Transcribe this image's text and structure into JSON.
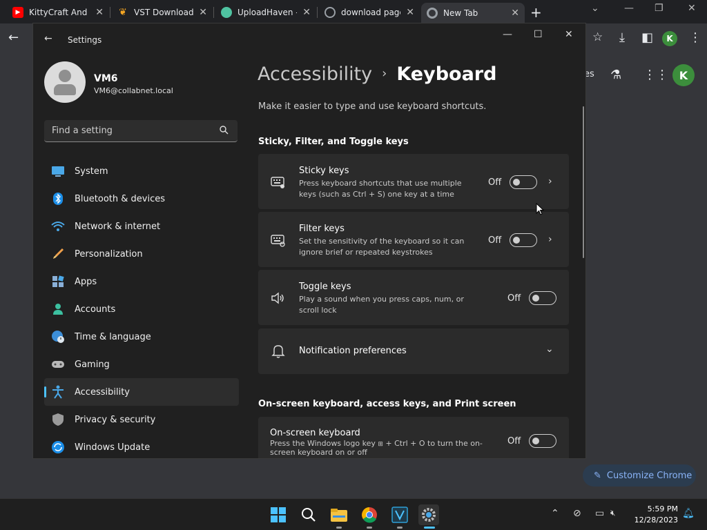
{
  "browser": {
    "tabs": [
      {
        "title": "KittyCraft And B",
        "favicon": "youtube-icon",
        "color": "#ff0000"
      },
      {
        "title": "VST Downloads",
        "favicon": "fl-studio-icon",
        "color": "#f5a623"
      },
      {
        "title": "UploadHaven -",
        "favicon": "cloud-icon",
        "color": "#4fc3a1"
      },
      {
        "title": "download page",
        "favicon": "globe-icon",
        "color": "#9aa0a6"
      },
      {
        "title": "New Tab",
        "favicon": "chrome-icon",
        "color": "#9aa0a6"
      }
    ],
    "profile_initial": "K",
    "page_partial_text": "es",
    "customize_label": "Customize Chrome"
  },
  "settings": {
    "app_title": "Settings",
    "user": {
      "name": "VM6",
      "email": "VM6@collabnet.local"
    },
    "search_placeholder": "Find a setting",
    "nav": [
      {
        "label": "System",
        "icon": "monitor-icon"
      },
      {
        "label": "Bluetooth & devices",
        "icon": "bluetooth-icon"
      },
      {
        "label": "Network & internet",
        "icon": "wifi-icon"
      },
      {
        "label": "Personalization",
        "icon": "brush-icon"
      },
      {
        "label": "Apps",
        "icon": "apps-icon"
      },
      {
        "label": "Accounts",
        "icon": "person-icon"
      },
      {
        "label": "Time & language",
        "icon": "globe-clock-icon"
      },
      {
        "label": "Gaming",
        "icon": "gamepad-icon"
      },
      {
        "label": "Accessibility",
        "icon": "accessibility-icon",
        "selected": true
      },
      {
        "label": "Privacy & security",
        "icon": "shield-icon"
      },
      {
        "label": "Windows Update",
        "icon": "update-icon"
      }
    ],
    "breadcrumb": {
      "parent": "Accessibility",
      "current": "Keyboard"
    },
    "subtitle": "Make it easier to type and use keyboard shortcuts.",
    "section1_title": "Sticky, Filter, and Toggle keys",
    "cards": [
      {
        "title": "Sticky keys",
        "desc": "Press keyboard shortcuts that use multiple keys (such as Ctrl + S) one key at a time",
        "state": "Off",
        "icon": "sticky-keys-icon"
      },
      {
        "title": "Filter keys",
        "desc": "Set the sensitivity of the keyboard so it can ignore brief or repeated keystrokes",
        "state": "Off",
        "icon": "filter-keys-icon"
      },
      {
        "title": "Toggle keys",
        "desc": "Play a sound when you press caps, num, or scroll lock",
        "state": "Off",
        "icon": "speaker-icon"
      }
    ],
    "notification_label": "Notification preferences",
    "section2_title": "On-screen keyboard, access keys, and Print screen",
    "osk": {
      "title": "On-screen keyboard",
      "desc_pre": "Press the Windows logo key",
      "desc_post": " + Ctrl + O to turn the on-screen keyboard on or off",
      "state": "Off"
    }
  },
  "taskbar": {
    "time": "5:59 PM",
    "date": "12/28/2023"
  }
}
